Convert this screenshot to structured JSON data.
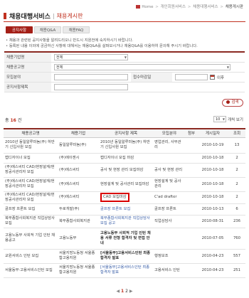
{
  "breadcrumb": {
    "home": "Home",
    "items": [
      "개인회원서비스",
      "채용대행서비스"
    ],
    "current": "채용게시판"
  },
  "title": {
    "main": "채용대행서비스",
    "sub": "채용게시판"
  },
  "tabs": [
    {
      "label": "공지사항",
      "active": true
    },
    {
      "label": "채용Q&A",
      "active": false
    },
    {
      "label": "채용FAQ",
      "active": false
    }
  ],
  "notes": [
    "채용과 관련된 공지사항을 알려드리오니 반드시 지원전에 숙지하시기 바랍니다.",
    "등록된 내용 이외에 궁금하신 사항에 대해서는 채용Q&A를 살펴보시거나 채용Q&A를 이용하여 문의해 주시기 바랍니다."
  ],
  "search": {
    "labels": {
      "company": "채용기업명",
      "type": "채용공고명",
      "field": "모집분야",
      "deadline": "접수마감일",
      "title": "공지사항제목"
    },
    "company_value": "전체",
    "type_value": "전체",
    "deadline_suffix": "이후",
    "button": "검색"
  },
  "list": {
    "count_prefix": "총",
    "count": "16",
    "count_suffix": "건",
    "perpage_value": "10",
    "perpage_label": "개씩 보기"
  },
  "table": {
    "headers": [
      "채용공고명",
      "채용기업",
      "공지사항 제목",
      "모집분야",
      "첨부",
      "게시일자",
      "조회"
    ],
    "rows": [
      {
        "a": "2010년 동일알루미늄(주) 하반기 신입사원 모집",
        "b": "동일알루미늄(주)",
        "c": "2010년 동일알루미늄(주) 하반기 신입사원 모집",
        "d": "영업관리, 사무관리",
        "e": "",
        "f": "2010-10-19",
        "g": "13"
      },
      {
        "a": "캡디자이너 모집",
        "b": "(주)에이젠시",
        "c": "캡디자이너 모집 마감",
        "d": "",
        "e": "",
        "f": "2010-10-18",
        "g": "2"
      },
      {
        "a": "(주)에스씨티 CAD/현장설계/현장공사관리자 모집",
        "b": "(주)에스씨티",
        "c": "공사 및 현장 관리 모집마감",
        "d": "공사 및 현장 관리",
        "e": "",
        "f": "2010-10-18",
        "g": "2"
      },
      {
        "a": "(주)에스씨티 CAD/현장설계/현장공사관리자 모집",
        "b": "(주)에스씨티",
        "c": "현장설계 및 공사관리 모집마감",
        "d": "현장설계 및 공사관리",
        "e": "",
        "f": "2010-10-18",
        "g": "2"
      },
      {
        "a": "(주)에스씨티 CAD/현장설계/현장공사관리자 모집",
        "b": "(주)에스씨티",
        "c": "CAD 모집마감",
        "d": "C'ad drafter",
        "e": "",
        "f": "2010-10-18",
        "g": "2",
        "highlight": true
      },
      {
        "a": "골프장 프론트 모집",
        "b": "두로개발(주)",
        "c": "골프장 프론트 모집",
        "d": "골프장 프론트",
        "e": "",
        "f": "2010-10-13",
        "g": "6",
        "link": true
      },
      {
        "a": "북부종합사회복지관 직업상담사 모집",
        "b": "북부종합사회복지관",
        "c": "북부종합사회복지관 직업상담사 모집 공고",
        "d": "직업상담사",
        "e": "",
        "f": "2010-08-31",
        "g": "236",
        "link": true
      },
      {
        "a": "고용노동부 사회적 기업 인턴 채용공고",
        "b": "고용노동부",
        "c": "고용노동부 사회적 기업 인턴 채용 서류 전형 합격자 및 면접 안내",
        "d": "",
        "e": "",
        "f": "2010-07-05",
        "g": "760",
        "bold": true
      },
      {
        "a": "교원서비스 인턴 모집",
        "b": "서울지방노동청 서울종합고용지원",
        "c": "[서울동부]고용서비스인턴 최종합격자 발표",
        "d": "행정보조",
        "e": "",
        "f": "2010-04-23",
        "g": "557",
        "bold": true
      },
      {
        "a": "서울동부·고용서비스인턴 모집",
        "b": "서울지방노동청 서울종합고용지원",
        "c": "[서울동부]고용서비스인턴 최종합격자 발표",
        "d": "고용서비스 인턴",
        "e": "",
        "f": "2010-04-23",
        "g": "251",
        "link": true
      }
    ]
  },
  "pager": {
    "pages": [
      "1",
      "2"
    ],
    "current": "1"
  }
}
